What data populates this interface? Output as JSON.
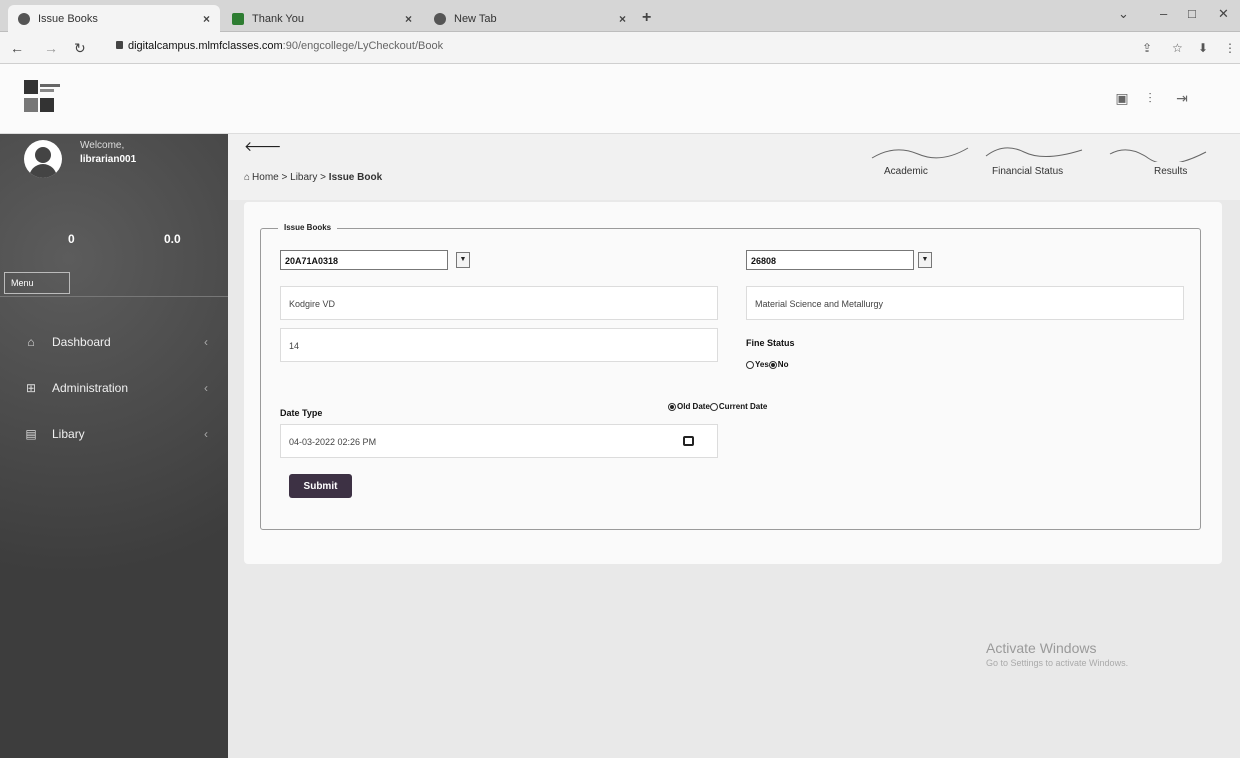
{
  "browser": {
    "tabs": [
      {
        "title": "Issue Books",
        "active": true
      },
      {
        "title": "Thank You",
        "active": false
      },
      {
        "title": "New Tab",
        "active": false
      }
    ],
    "url_host": "digitalcampus.mlmfclasses.com",
    "url_path": ":90/engcollege/LyCheckout/Book",
    "new_tab_symbol": "+",
    "tab_close_symbol": "×"
  },
  "sidebar": {
    "welcome": "Welcome,",
    "username": "librarian001",
    "stat_left": "0",
    "stat_right": "0.0",
    "menu_label": "Menu",
    "items": [
      {
        "label": "Dashboard",
        "icon": "home-icon"
      },
      {
        "label": "Administration",
        "icon": "grid-icon"
      },
      {
        "label": "Libary",
        "icon": "book-icon"
      }
    ]
  },
  "breadcrumb": {
    "home": "Home",
    "section": "Libary",
    "current": "Issue Book",
    "separator": ">"
  },
  "topnav": {
    "academic": "Academic",
    "financial": "Financial Status",
    "results": "Results"
  },
  "form": {
    "legend": "Issue Books",
    "student_id": "20A71A0318",
    "book_id": "26808",
    "student_name": "Kodgire VD",
    "book_title": "Material Science and Metallurgy",
    "count": "14",
    "fine_status_label": "Fine Status",
    "fine_yes": "Yes",
    "fine_no": "No",
    "fine_selected": "No",
    "date_type_label": "Date Type",
    "old_date": "Old Date",
    "current_date": "Current Date",
    "date_selected": "Old Date",
    "date_value": "04-03-2022 02:26 PM",
    "submit": "Submit"
  },
  "watermark": {
    "title": "Activate Windows",
    "subtitle": "Go to Settings to activate Windows."
  }
}
